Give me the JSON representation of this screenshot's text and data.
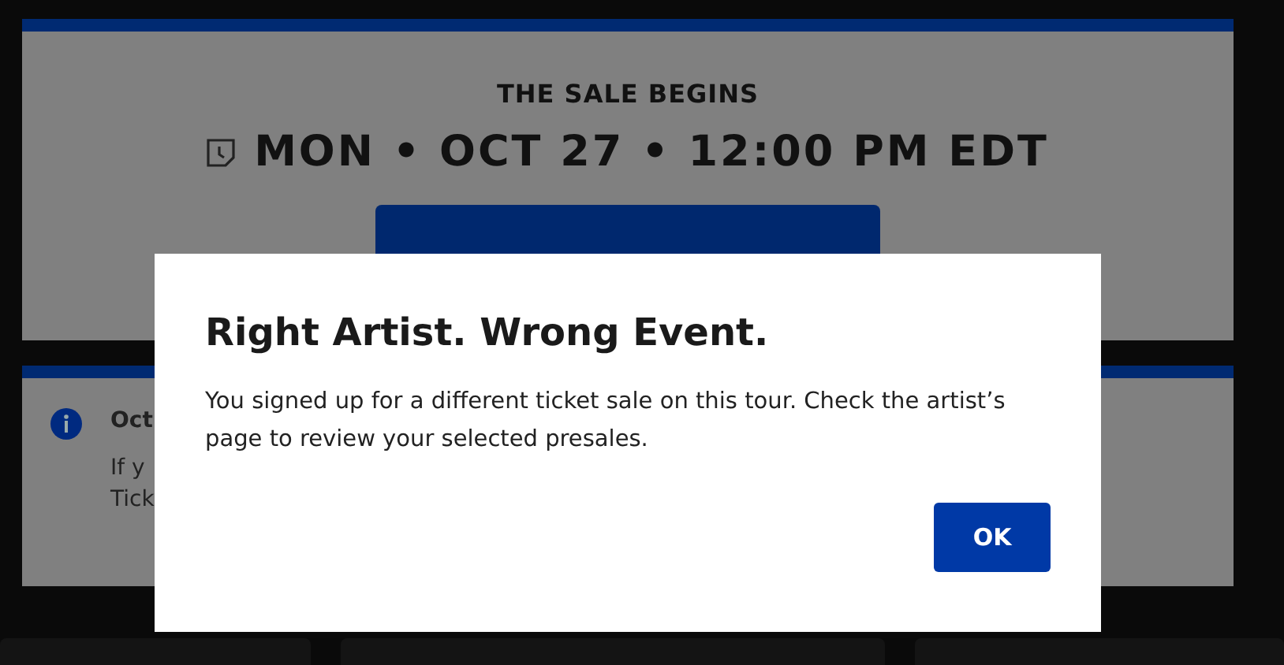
{
  "sale_card": {
    "heading": "THE SALE BEGINS",
    "datetime": "MON • OCT 27 • 12:00 PM EDT"
  },
  "notice_card": {
    "title": "Oct",
    "lines": [
      "If y",
      "Tick"
    ]
  },
  "dialog": {
    "title": "Right Artist. Wrong Event.",
    "message": "You signed up for a different ticket sale on this tour. Check the artist’s page to review your selected presales.",
    "button": "OK"
  }
}
